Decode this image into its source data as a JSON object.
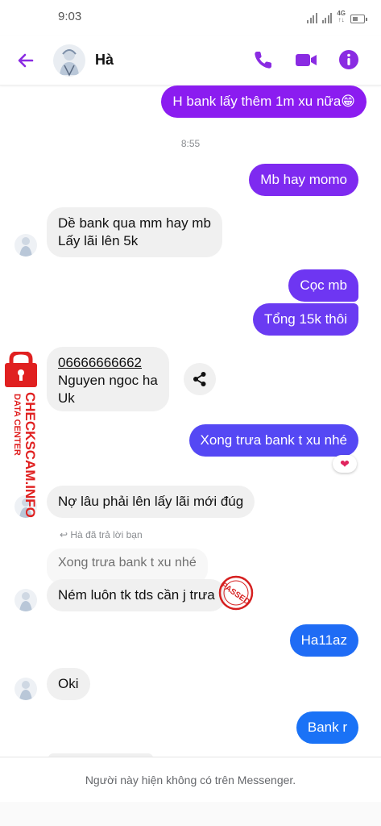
{
  "status_bar": {
    "time": "9:03",
    "network": "4G",
    "network_sub": "↑↓"
  },
  "header": {
    "contact_name": "Hà"
  },
  "colors": {
    "accent": "#8a2be2",
    "outgoing_top": "#8b1cf0",
    "outgoing_bottom": "#1a72f6",
    "incoming": "#f0f0f0"
  },
  "messages": [
    {
      "text": "H bank lấy thêm 1m xu nữa😁",
      "dir": "out"
    },
    {
      "text": "8:55",
      "dir": "time"
    },
    {
      "text": "Mb hay momo",
      "dir": "out"
    },
    {
      "lines": [
        "Dề bank qua mm hay mb",
        "Lấy lãi lên 5k"
      ],
      "dir": "in"
    },
    {
      "text": "Cọc mb",
      "dir": "out"
    },
    {
      "text": "Tổng 15k thôi",
      "dir": "out"
    },
    {
      "lines": [
        "06666666662",
        "Nguyen ngoc ha",
        "Uk"
      ],
      "dir": "in"
    },
    {
      "text": "Xong trưa bank t xu nhé",
      "dir": "out",
      "reaction": "❤"
    },
    {
      "text": "Nợ lâu phải lên lấy lãi mới đúg",
      "dir": "in"
    },
    {
      "text": "Ném luôn tk tds cần j trưa",
      "dir": "in",
      "reply_label": "Hà đã trả lời bạn",
      "quoted": "Xong trưa bank t xu nhé"
    },
    {
      "text": "Ha11az",
      "dir": "out"
    },
    {
      "text": "Oki",
      "dir": "in"
    },
    {
      "text": "Bank r",
      "dir": "out"
    }
  ],
  "watermark": {
    "line1": "DATA CENTER",
    "line2": "CHECKSCAM.INFO"
  },
  "stamp": {
    "text": "PASSED"
  },
  "footer": {
    "notice": "Người này hiện không có trên Messenger."
  }
}
